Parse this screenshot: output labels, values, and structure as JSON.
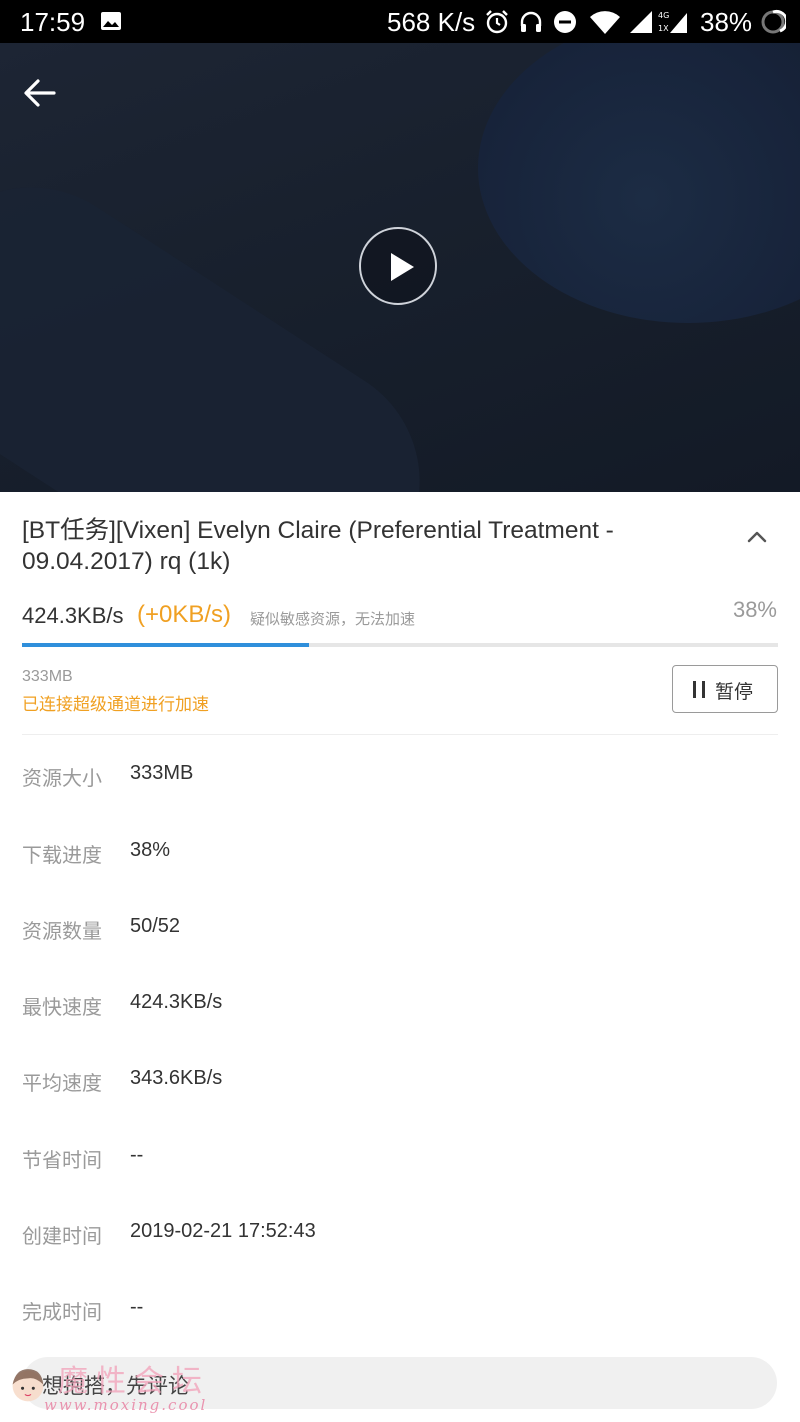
{
  "status_bar": {
    "time": "17:59",
    "net_speed": "568 K/s",
    "battery": "38%",
    "icons": [
      "image-icon",
      "alarm-icon",
      "headphones-icon",
      "dnd-icon",
      "wifi-icon",
      "signal-icon",
      "signal-4g-icon",
      "battery-icon"
    ]
  },
  "video": {
    "back_icon": "arrow-left-icon",
    "play_icon": "play-icon",
    "background": "#18202d"
  },
  "task": {
    "title": "[BT任务][Vixen] Evelyn Claire (Preferential Treatment - 09.04.2017) rq (1k)",
    "collapse_icon": "chevron-up-icon",
    "speed": "424.3KB/s",
    "speed_bonus": "(+0KB/s)",
    "speed_note": "疑似敏感资源，无法加速",
    "percent": "38%",
    "progress": 0.38,
    "size": "333MB",
    "accel_status": "已连接超级通道进行加速",
    "pause_label": "暂停",
    "accent_color": "#2f8fdb",
    "warning_color": "#f0a022"
  },
  "info": [
    {
      "label": "资源大小",
      "value": "333MB"
    },
    {
      "label": "下载进度",
      "value": "38%"
    },
    {
      "label": "资源数量",
      "value": "50/52"
    },
    {
      "label": "最快速度",
      "value": "424.3KB/s"
    },
    {
      "label": "平均速度",
      "value": "343.6KB/s"
    },
    {
      "label": "节省时间",
      "value": "--"
    },
    {
      "label": "创建时间",
      "value": "2019-02-21 17:52:43"
    },
    {
      "label": "完成时间",
      "value": "--"
    }
  ],
  "comment": {
    "placeholder": "想抱搭，先评论"
  },
  "watermark": {
    "line1": "魔性会坛",
    "line2": "www.moxing.cool"
  }
}
